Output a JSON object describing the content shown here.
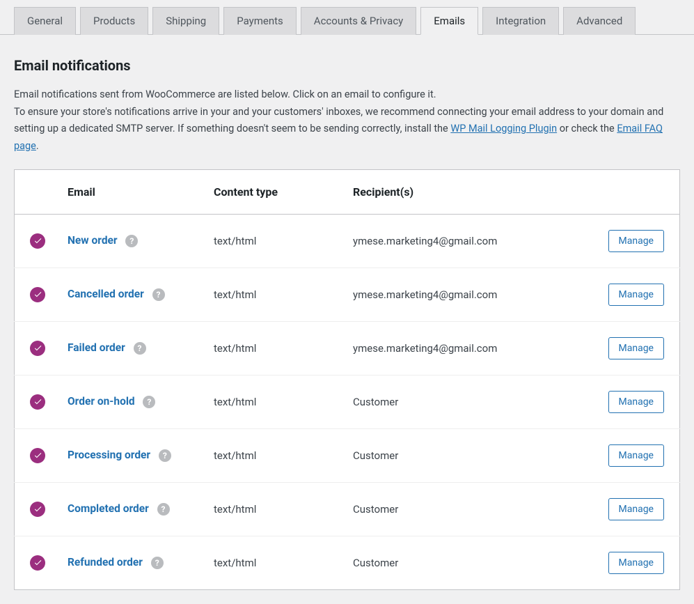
{
  "tabs": [
    {
      "label": "General",
      "active": false
    },
    {
      "label": "Products",
      "active": false
    },
    {
      "label": "Shipping",
      "active": false
    },
    {
      "label": "Payments",
      "active": false
    },
    {
      "label": "Accounts & Privacy",
      "active": false
    },
    {
      "label": "Emails",
      "active": true
    },
    {
      "label": "Integration",
      "active": false
    },
    {
      "label": "Advanced",
      "active": false
    }
  ],
  "page": {
    "title": "Email notifications",
    "intro_line1": "Email notifications sent from WooCommerce are listed below. Click on an email to configure it.",
    "intro_line2_a": "To ensure your store's notifications arrive in your and your customers' inboxes, we recommend connecting your email address to your domain and setting up a dedicated SMTP server. If something doesn't seem to be sending correctly, install the ",
    "intro_link1": "WP Mail Logging Plugin",
    "intro_line2_b": " or check the ",
    "intro_link2": "Email FAQ page",
    "intro_line2_c": "."
  },
  "table": {
    "headers": {
      "status": "",
      "email": "Email",
      "content_type": "Content type",
      "recipients": "Recipient(s)",
      "manage": ""
    },
    "manage_label": "Manage",
    "rows": [
      {
        "name": "New order",
        "content_type": "text/html",
        "recipients": "ymese.marketing4@gmail.com"
      },
      {
        "name": "Cancelled order",
        "content_type": "text/html",
        "recipients": "ymese.marketing4@gmail.com"
      },
      {
        "name": "Failed order",
        "content_type": "text/html",
        "recipients": "ymese.marketing4@gmail.com"
      },
      {
        "name": "Order on-hold",
        "content_type": "text/html",
        "recipients": "Customer"
      },
      {
        "name": "Processing order",
        "content_type": "text/html",
        "recipients": "Customer"
      },
      {
        "name": "Completed order",
        "content_type": "text/html",
        "recipients": "Customer"
      },
      {
        "name": "Refunded order",
        "content_type": "text/html",
        "recipients": "Customer"
      }
    ]
  }
}
